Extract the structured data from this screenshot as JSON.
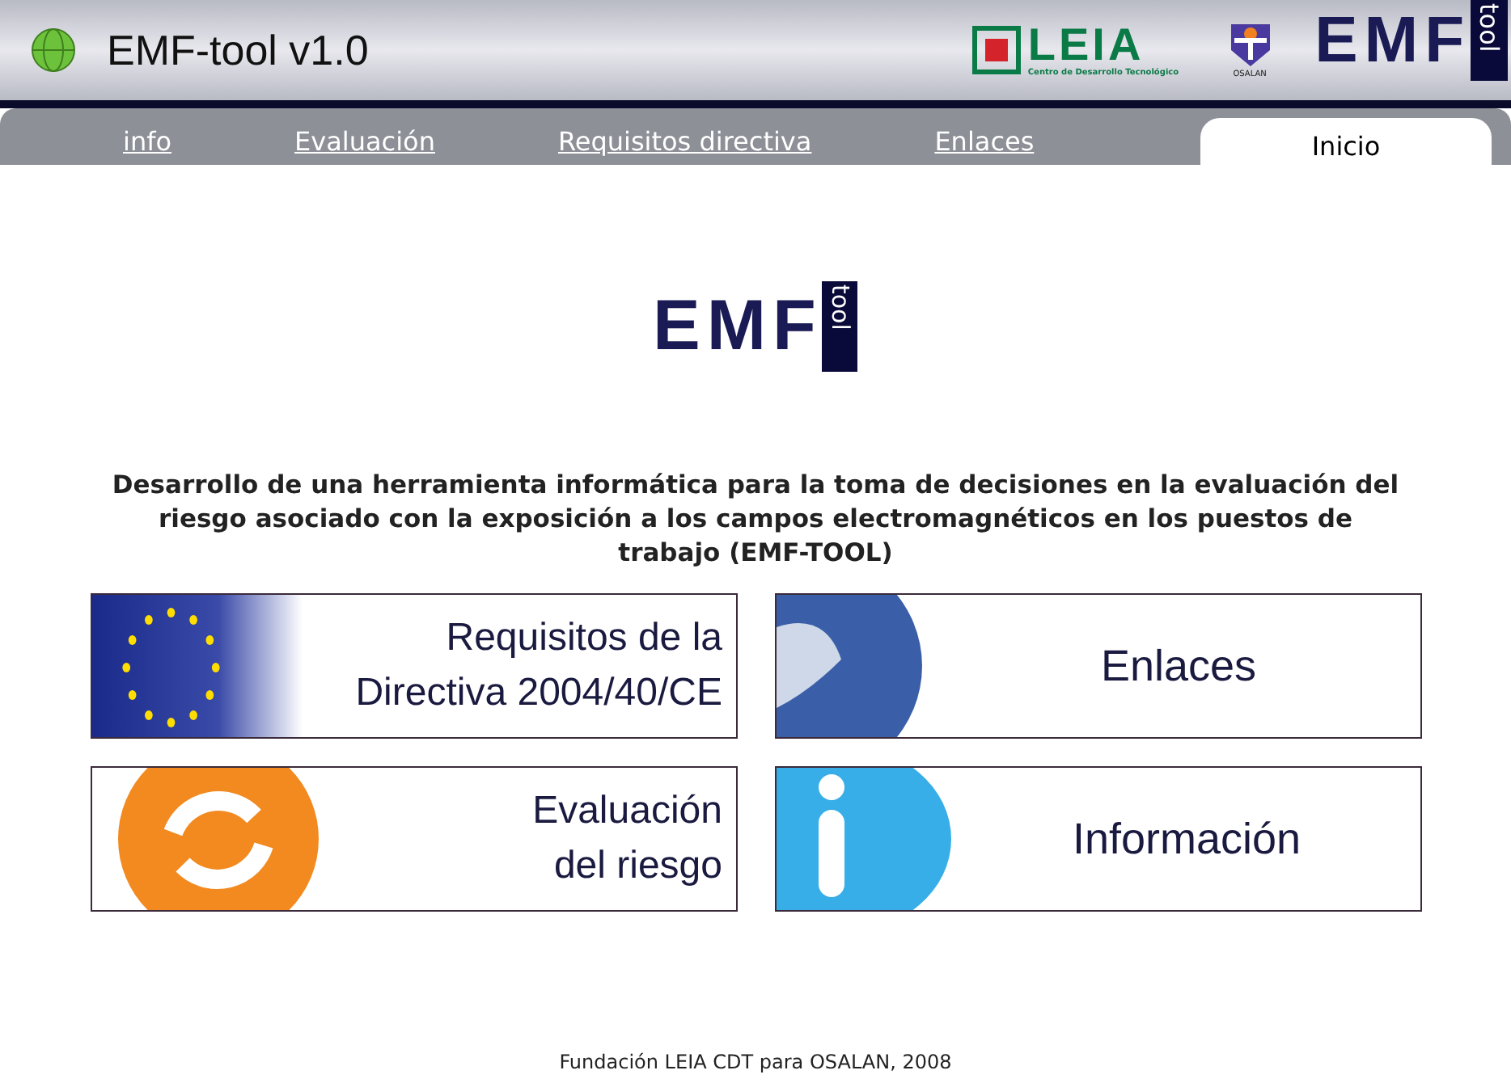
{
  "window": {
    "title": "EMF-tool v1.0"
  },
  "logos": {
    "leia": {
      "name": "LEIA",
      "subtitle": "Centro de Desarrollo Tecnológico"
    },
    "osalan": {
      "name": "OSALAN"
    },
    "emf": {
      "name": "EMF",
      "tag": "tool"
    }
  },
  "tabs": [
    {
      "label": "info",
      "selected": false
    },
    {
      "label": "Evaluación",
      "selected": false
    },
    {
      "label": "Requisitos directiva",
      "selected": false
    },
    {
      "label": "Enlaces",
      "selected": false
    },
    {
      "label": "Inicio",
      "selected": true
    }
  ],
  "main": {
    "logo": {
      "name": "EMF",
      "tag": "tool"
    },
    "heading": "Desarrollo de una herramienta informática para la toma de decisiones en la evaluación del riesgo asociado con la exposición a los campos electromagnéticos en los puestos de trabajo (EMF-TOOL)",
    "cards": [
      {
        "kind": "eu",
        "lines": [
          "Requisitos de la",
          "Directiva 2004/40/CE"
        ]
      },
      {
        "kind": "globe",
        "lines": [
          "Enlaces"
        ]
      },
      {
        "kind": "refresh",
        "lines": [
          "Evaluación",
          "del riesgo"
        ]
      },
      {
        "kind": "info",
        "lines": [
          "Información"
        ]
      }
    ]
  },
  "footer": "Fundación LEIA CDT para OSALAN, 2008"
}
